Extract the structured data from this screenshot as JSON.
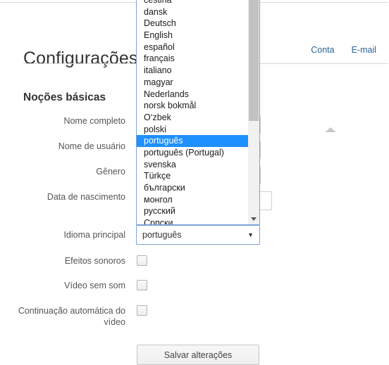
{
  "page": {
    "title": "Configurações",
    "section_title": "Noções básicas"
  },
  "tabs": [
    {
      "label": "Conta",
      "active": true
    },
    {
      "label": "E-mail",
      "active": false
    }
  ],
  "form": {
    "rows": [
      {
        "label": "Nome completo",
        "type": "text",
        "value": ""
      },
      {
        "label": "Nome de usuário",
        "type": "text",
        "value": ""
      },
      {
        "label": "Gênero",
        "type": "text",
        "value": ""
      },
      {
        "label": "Data de nascimento",
        "type": "date",
        "value": ""
      },
      {
        "label": "Idioma principal",
        "type": "select",
        "value": "português"
      },
      {
        "label": "Efeitos sonoros",
        "type": "checkbox",
        "checked": false
      },
      {
        "label": "Vídeo sem som",
        "type": "checkbox",
        "checked": false
      },
      {
        "label": "Continuação automática do vídeo",
        "type": "checkbox",
        "checked": false
      }
    ]
  },
  "language_select": {
    "selected": "português",
    "caret": "▼",
    "options": [
      "čeština",
      "dansk",
      "Deutsch",
      "English",
      "español",
      "français",
      "italiano",
      "magyar",
      "Nederlands",
      "norsk bokmål",
      "O‘zbek",
      "polski",
      "português",
      "português (Portugal)",
      "svenska",
      "Türkçe",
      "български",
      "монгол",
      "русский",
      "Српски"
    ],
    "scroll_arrow_down": "▼"
  },
  "actions": {
    "save_label": "Salvar alterações"
  },
  "colors": {
    "highlight": "#1e90ff",
    "link": "#2a6496",
    "focus_border": "#7aa3d8",
    "text": "#333333"
  }
}
